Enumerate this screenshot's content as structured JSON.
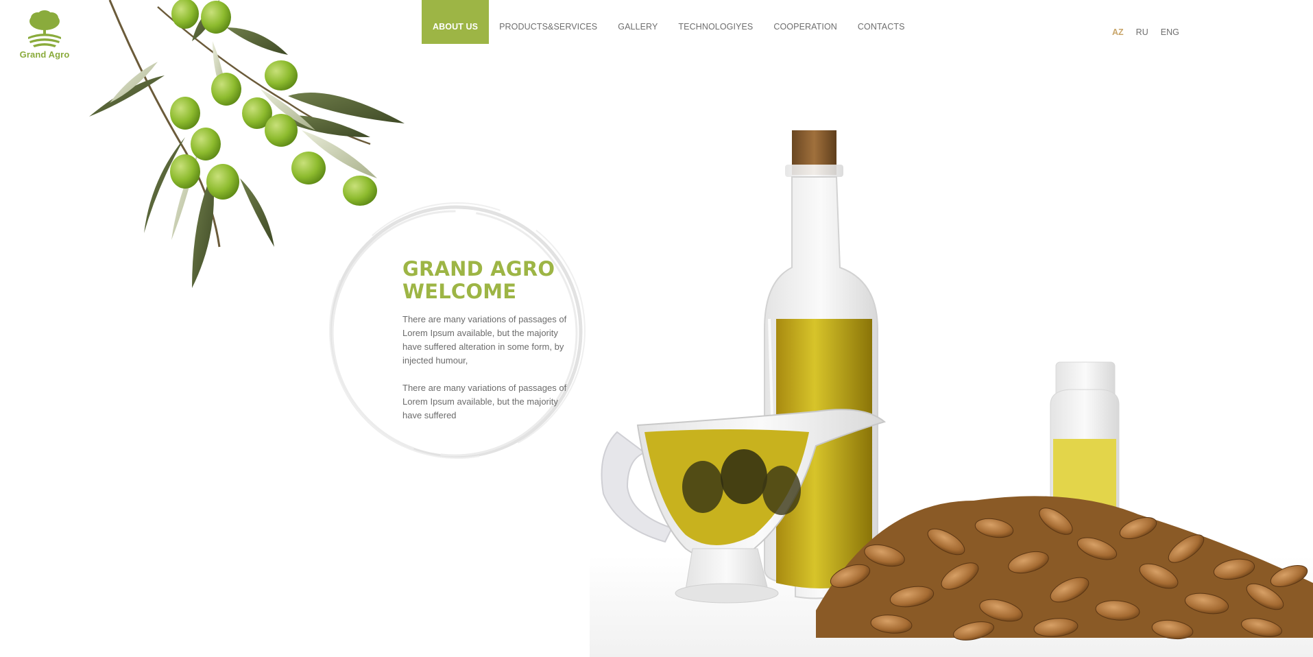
{
  "brand": {
    "name": "Grand Agro",
    "logo_icon": "tree-field-icon",
    "accent_color": "#9db545",
    "active_lang_color": "#c8a56a"
  },
  "nav": {
    "items": [
      {
        "label": "ABOUT US",
        "active": true
      },
      {
        "label": "PRODUCTS&SERVICES",
        "active": false
      },
      {
        "label": "GALLERY",
        "active": false
      },
      {
        "label": "TECHNOLOGIYES",
        "active": false
      },
      {
        "label": "COOPERATION",
        "active": false
      },
      {
        "label": "CONTACTS",
        "active": false
      }
    ]
  },
  "languages": [
    {
      "label": "AZ",
      "active": true
    },
    {
      "label": "RU",
      "active": false
    },
    {
      "label": "ENG",
      "active": false
    }
  ],
  "welcome": {
    "title_line1": "GRAND AGRO",
    "title_line2": "WELCOME",
    "paragraph1": "There are many variations of passages of Lorem Ipsum available, but the majority have suffered alteration in some form, by injected humour,",
    "paragraph2": "There are many variations of passages of Lorem Ipsum available, but the majority have suffered"
  },
  "images": {
    "branch": "olive-branch-image",
    "products": "olive-oil-and-almonds-image"
  }
}
